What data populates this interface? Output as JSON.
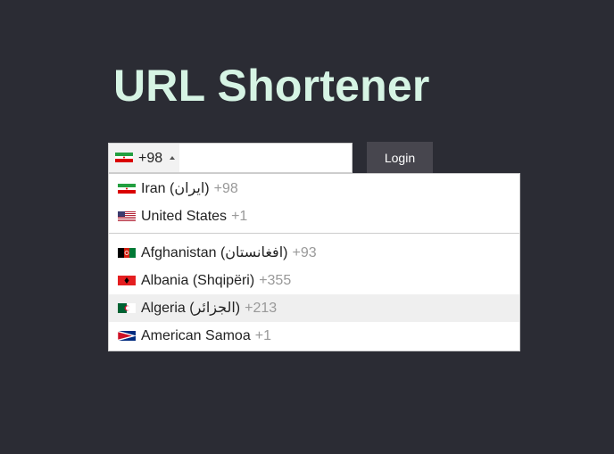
{
  "app": {
    "title": "URL Shortener"
  },
  "phone": {
    "selected_flag": "iran-flag-icon",
    "selected_dial_code": "+98",
    "number_value": "",
    "placeholder": ""
  },
  "login": {
    "label": "Login"
  },
  "countries": {
    "preferred": [
      {
        "name": "Iran (ایران)",
        "dial_code": "+98",
        "flag": "iran-flag-icon"
      },
      {
        "name": "United States",
        "dial_code": "+1",
        "flag": "usa-flag-icon"
      }
    ],
    "all": [
      {
        "name": "Afghanistan (افغانستان)",
        "dial_code": "+93",
        "flag": "afghanistan-flag-icon"
      },
      {
        "name": "Albania (Shqipëri)",
        "dial_code": "+355",
        "flag": "albania-flag-icon"
      },
      {
        "name": "Algeria (الجزائر)",
        "dial_code": "+213",
        "flag": "algeria-flag-icon",
        "highlighted": true
      },
      {
        "name": "American Samoa",
        "dial_code": "+1",
        "flag": "american-samoa-flag-icon"
      }
    ]
  },
  "colors": {
    "background": "#2b2c34",
    "title": "#d6f4e4",
    "button": "#47464e",
    "dial_code_text": "#999999",
    "highlight_row": "#efefef"
  }
}
